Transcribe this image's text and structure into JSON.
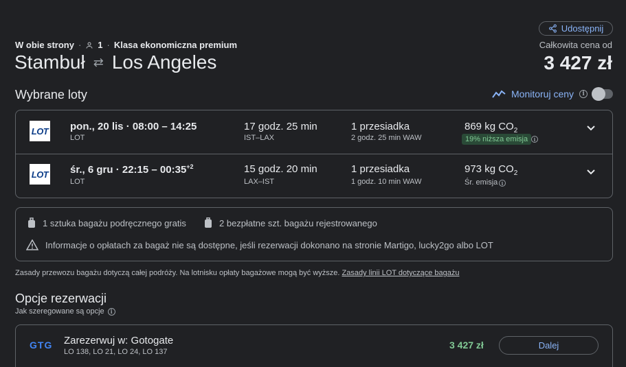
{
  "share": {
    "label": "Udostępnij"
  },
  "trip": {
    "type": "W obie strony",
    "passengers": "1",
    "cabin": "Klasa ekonomiczna premium"
  },
  "route": {
    "from": "Stambuł",
    "to": "Los Angeles"
  },
  "total": {
    "label": "Całkowita cena od",
    "price": "3 427 zł"
  },
  "selected": {
    "title": "Wybrane loty",
    "monitor_label": "Monitoruj ceny"
  },
  "flights": [
    {
      "logo": "LOT",
      "date": "pon., 20 lis",
      "times": "08:00 – 14:25",
      "airline": "LOT",
      "duration": "17 godz. 25 min",
      "airports": "IST–LAX",
      "stops": "1 przesiadka",
      "layover": "2 godz. 25 min WAW",
      "emissions": "869 kg CO",
      "emissions_sub": "2",
      "emission_note": "19% niższa emisja"
    },
    {
      "logo": "LOT",
      "date": "śr., 6 gru",
      "times": "22:15 – 00:35",
      "times_sup": "+2",
      "airline": "LOT",
      "duration": "15 godz. 20 min",
      "airports": "LAX–IST",
      "stops": "1 przesiadka",
      "layover": "1 godz. 10 min WAW",
      "emissions": "973 kg CO",
      "emissions_sub": "2",
      "emission_note": "Śr. emisja"
    }
  ],
  "baggage": {
    "carry_on": "1 sztuka bagażu podręcznego gratis",
    "checked": "2 bezpłatne szt. bagażu rejestrowanego",
    "warning": "Informacje o opłatach za bagaż nie są dostępne, jeśli rezerwacji dokonano na stronie Martigo, lucky2go albo LOT"
  },
  "policy": {
    "text": "Zasady przewozu bagażu dotyczą całej podróży. Na lotnisku opłaty bagażowe mogą być wyższe.",
    "link": "Zasady linii LOT dotyczące bagażu"
  },
  "booking": {
    "title": "Opcje rezerwacji",
    "sort_note": "Jak szeregowane są opcje",
    "options": [
      {
        "logo": "GTG",
        "title": "Zarezerwuj w: Gotogate",
        "flights": "LO 138, LO 21, LO 24, LO 137",
        "price": "3 427 zł",
        "button": "Dalej"
      }
    ]
  },
  "colors": {
    "background": "#202124",
    "accent": "#8ab4f8",
    "price_green": "#81c995",
    "border": "#5f6368"
  }
}
